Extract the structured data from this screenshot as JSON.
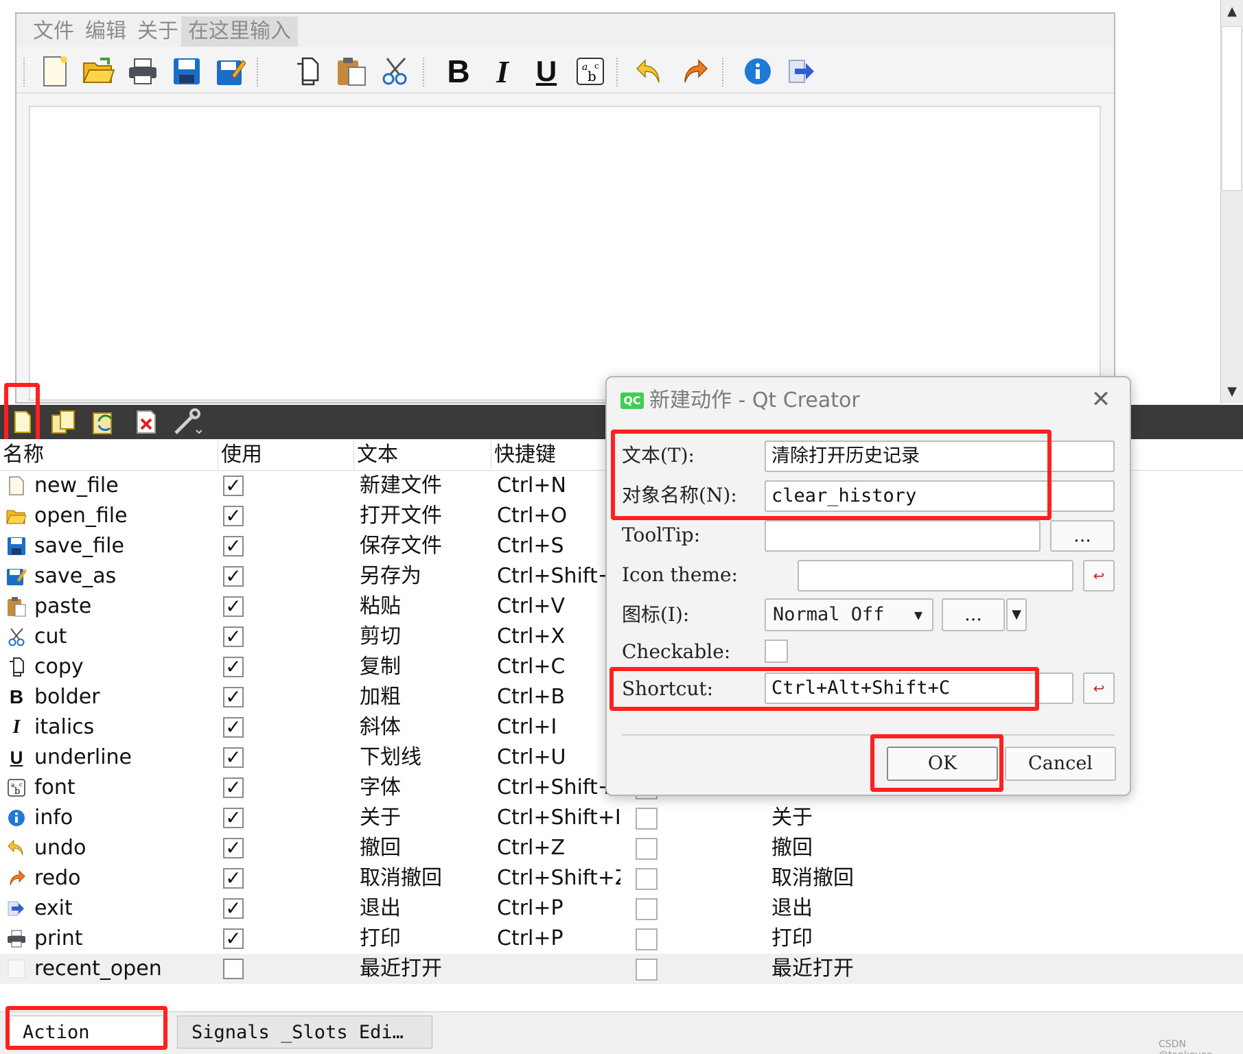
{
  "menubar": {
    "items": [
      "文件",
      "编辑",
      "关于",
      "在这里输入"
    ]
  },
  "toolbar_icons": [
    "new-file-icon",
    "open-file-icon",
    "print-icon",
    "save-icon",
    "save-as-icon",
    "copy-icon",
    "paste-icon",
    "cut-icon",
    "bold-icon",
    "italic-icon",
    "underline-icon",
    "font-icon",
    "undo-icon",
    "redo-icon",
    "info-icon",
    "exit-icon"
  ],
  "action_toolbar_icons": [
    "new-action-icon",
    "copy-action-icon",
    "paste-action-icon",
    "delete-action-icon",
    "configure-icon"
  ],
  "table": {
    "headers": [
      "名称",
      "使用",
      "文本",
      "快捷键"
    ],
    "rows": [
      {
        "name": "new_file",
        "icon": "new-file-icon",
        "used": "✓",
        "text": "新建文件",
        "shortcut": "Ctrl+N",
        "tooltip": ""
      },
      {
        "name": "open_file",
        "icon": "open-file-icon",
        "used": "✓",
        "text": "打开文件",
        "shortcut": "Ctrl+O",
        "tooltip": ""
      },
      {
        "name": "save_file",
        "icon": "save-icon",
        "used": "✓",
        "text": "保存文件",
        "shortcut": "Ctrl+S",
        "tooltip": ""
      },
      {
        "name": "save_as",
        "icon": "save-as-icon",
        "used": "✓",
        "text": "另存为",
        "shortcut": "Ctrl+Shift+",
        "tooltip": ""
      },
      {
        "name": "paste",
        "icon": "paste-icon",
        "used": "✓",
        "text": "粘贴",
        "shortcut": "Ctrl+V",
        "tooltip": ""
      },
      {
        "name": "cut",
        "icon": "cut-icon",
        "used": "✓",
        "text": "剪切",
        "shortcut": "Ctrl+X",
        "tooltip": ""
      },
      {
        "name": "copy",
        "icon": "copy-icon",
        "used": "✓",
        "text": "复制",
        "shortcut": "Ctrl+C",
        "tooltip": ""
      },
      {
        "name": "bolder",
        "icon": "bold-icon",
        "used": "✓",
        "text": "加粗",
        "shortcut": "Ctrl+B",
        "tooltip": ""
      },
      {
        "name": "italics",
        "icon": "italic-icon",
        "used": "✓",
        "text": "斜体",
        "shortcut": "Ctrl+I",
        "tooltip": ""
      },
      {
        "name": "underline",
        "icon": "underline-icon",
        "used": "✓",
        "text": "下划线",
        "shortcut": "Ctrl+U",
        "tooltip": ""
      },
      {
        "name": "font",
        "icon": "font-icon",
        "used": "✓",
        "text": "字体",
        "shortcut": "Ctrl+Shift+",
        "tooltip": ""
      },
      {
        "name": "info",
        "icon": "info-icon",
        "used": "✓",
        "text": "关于",
        "shortcut": "Ctrl+Shift+I",
        "tooltip": "关于"
      },
      {
        "name": "undo",
        "icon": "undo-icon",
        "used": "✓",
        "text": "撤回",
        "shortcut": "Ctrl+Z",
        "tooltip": "撤回"
      },
      {
        "name": "redo",
        "icon": "redo-icon",
        "used": "✓",
        "text": "取消撤回",
        "shortcut": "Ctrl+Shift+Z",
        "tooltip": "取消撤回"
      },
      {
        "name": "exit",
        "icon": "exit-icon",
        "used": "✓",
        "text": "退出",
        "shortcut": "Ctrl+P",
        "tooltip": "退出"
      },
      {
        "name": "print",
        "icon": "print-icon",
        "used": "✓",
        "text": "打印",
        "shortcut": "Ctrl+P",
        "tooltip": "打印"
      },
      {
        "name": "recent_open",
        "icon": "blank-icon",
        "used": "",
        "text": "最近打开",
        "shortcut": "",
        "tooltip": "最近打开"
      }
    ]
  },
  "tabs": [
    "Action Editor",
    "Signals _Slots Edi…"
  ],
  "watermark": "CSDN @tankeven",
  "dialog": {
    "title": "新建动作 - Qt Creator",
    "qc_badge": "QC",
    "close": "✕",
    "text_label": "文本(T):",
    "text_value": "清除打开历史记录",
    "object_label": "对象名称(N):",
    "object_value": "clear_history",
    "tooltip_label": "ToolTip:",
    "tooltip_value": "",
    "tooltip_more": "...",
    "icon_theme_label": "Icon theme:",
    "icon_theme_value": "",
    "icon_label": "图标(I):",
    "icon_mode": "Normal Off",
    "icon_more": "...",
    "checkable_label": "Checkable:",
    "shortcut_label": "Shortcut:",
    "shortcut_value": "Ctrl+Alt+Shift+C",
    "ok_label": "OK",
    "cancel_label": "Cancel"
  },
  "colors": {
    "highlight": "#ff2020",
    "qt_green": "#41cd52",
    "action_toolbar_bg": "#3a3a3a"
  }
}
